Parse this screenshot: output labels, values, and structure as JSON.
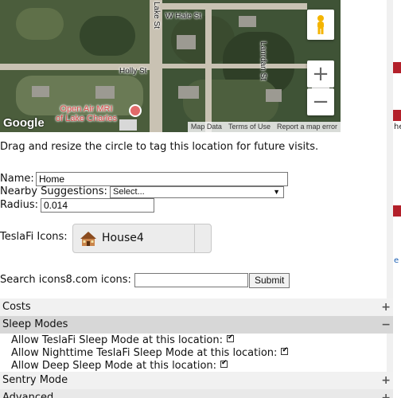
{
  "map": {
    "streets": [
      "W Hale St",
      "Lake St",
      "Holly St",
      "Lanrdan St"
    ],
    "poi_label": "Open Air MRI\nof Lake Charles",
    "google_logo": "Google",
    "attribution": [
      "Map Data",
      "Terms of Use",
      "Report a map error"
    ],
    "zoom_in_label": "+",
    "zoom_out_label": "−"
  },
  "instructions": "Drag and resize the circle to tag this location for future visits.",
  "form": {
    "name_label": "Name:",
    "name_value": "Home",
    "nearby_label": "Nearby Suggestions:",
    "nearby_selected": "Select...",
    "radius_label": "Radius:",
    "radius_value": "0.014",
    "icons_label": "TeslaFi Icons:",
    "icon_selected": "House4",
    "search_label": "Search icons8.com icons:",
    "search_value": "",
    "submit_label": "Submit"
  },
  "sections": {
    "costs": {
      "label": "Costs",
      "sign": "+"
    },
    "sleep": {
      "label": "Sleep Modes",
      "sign": "−",
      "options": [
        {
          "label": "Allow TeslaFi Sleep Mode at this location:",
          "checked": true
        },
        {
          "label": "Allow Nighttime TeslaFi Sleep Mode at this location:",
          "checked": true
        },
        {
          "label": "Allow Deep Sleep Mode at this location:",
          "checked": true
        }
      ]
    },
    "sentry": {
      "label": "Sentry Mode",
      "sign": "+"
    },
    "advanced": {
      "label": "Advanced",
      "sign": "+"
    }
  },
  "gutter_fragments": [
    "he",
    "e"
  ]
}
